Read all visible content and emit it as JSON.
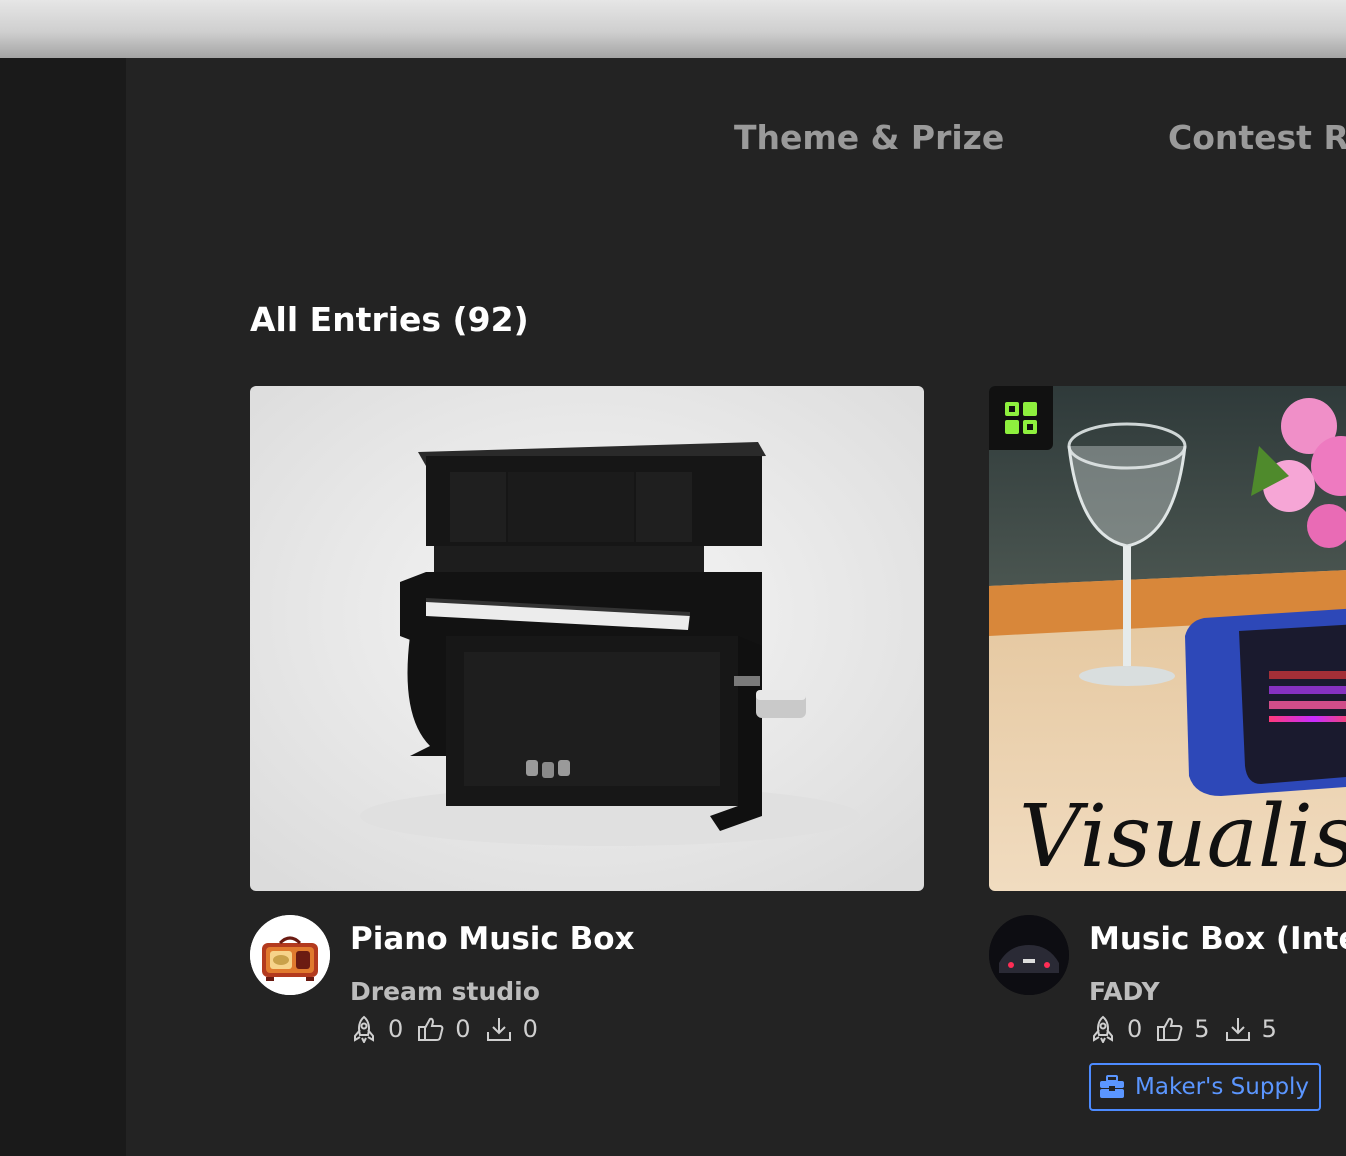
{
  "nav": {
    "tabs": [
      {
        "label": "Theme & Prize"
      },
      {
        "label": "Contest Ru"
      }
    ]
  },
  "section": {
    "title": "All Entries (92)"
  },
  "entries": [
    {
      "title": "Piano Music Box",
      "author": "Dream studio",
      "stats": {
        "boosts": "0",
        "likes": "0",
        "downloads": "0"
      }
    },
    {
      "title": "Music Box (Inter",
      "author": "FADY",
      "stats": {
        "boosts": "0",
        "likes": "5",
        "downloads": "5"
      },
      "image_text": "Visualise",
      "tag_label": "Maker's Supply"
    }
  ],
  "colors": {
    "accent_blue": "#4d8bff",
    "badge_green": "#8ef03e",
    "background": "#232323"
  },
  "icons": [
    "boost-icon",
    "like-icon",
    "download-icon",
    "toolbox-icon",
    "cube-badge-icon"
  ]
}
